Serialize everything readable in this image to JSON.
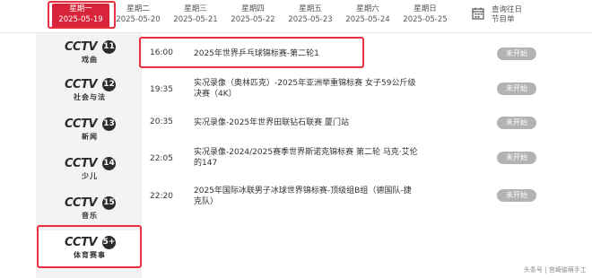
{
  "dates": [
    {
      "weekday": "星期一",
      "date": "2025-05-19",
      "active": true
    },
    {
      "weekday": "星期二",
      "date": "2025-05-20",
      "active": false
    },
    {
      "weekday": "星期三",
      "date": "2025-05-21",
      "active": false
    },
    {
      "weekday": "星期四",
      "date": "2025-05-22",
      "active": false
    },
    {
      "weekday": "星期五",
      "date": "2025-05-23",
      "active": false
    },
    {
      "weekday": "星期六",
      "date": "2025-05-24",
      "active": false
    },
    {
      "weekday": "星期日",
      "date": "2025-05-25",
      "active": false
    }
  ],
  "history": {
    "line1": "查询往日",
    "line2": "节目单",
    "icon": "calendar-icon"
  },
  "channels": [
    {
      "num": "11",
      "sub": "戏曲"
    },
    {
      "num": "12",
      "sub": "社会与法"
    },
    {
      "num": "13",
      "sub": "新闻"
    },
    {
      "num": "14",
      "sub": "少儿"
    },
    {
      "num": "15",
      "sub": "音乐"
    },
    {
      "num": "5+",
      "sub": "体育赛事",
      "selected": true
    }
  ],
  "channel_brand": "CCTV",
  "programs": [
    {
      "time": "16:00",
      "title": "2025年世界乒乓球锦标赛-第二轮1",
      "status": "未开始"
    },
    {
      "time": "19:35",
      "title": "实况录像（奥林匹克）-2025年亚洲举重锦标赛 女子59公斤级决赛（4K）",
      "status": "未开始"
    },
    {
      "time": "20:35",
      "title": "实况录像-2025年世界田联钻石联赛 厦门站",
      "status": "未开始"
    },
    {
      "time": "22:05",
      "title": "实况录像-2024/2025赛季世界斯诺克锦标赛 第二轮 马克·艾伦的147",
      "status": "未开始"
    },
    {
      "time": "22:20",
      "title": "2025年国际冰联男子冰球世界锦标赛-顶级组B组（德国队-捷克队）",
      "status": "未开始"
    }
  ],
  "watermark": "头条号 | 宫崎骏萌手工",
  "colors": {
    "active_tab": "#d7243a",
    "highlight_outline": "#e8303f",
    "status_badge": "#b3b3b3"
  }
}
